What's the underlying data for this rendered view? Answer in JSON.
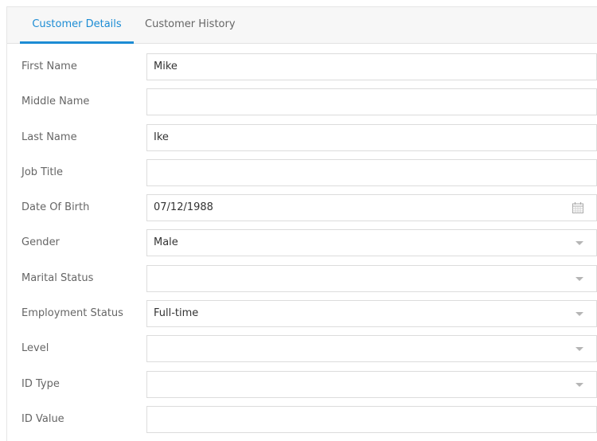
{
  "tabs": [
    {
      "label": "Customer Details",
      "active": true
    },
    {
      "label": "Customer History",
      "active": false
    }
  ],
  "accent_color": "#1c8cd4",
  "fields": {
    "first_name": {
      "label": "First Name",
      "value": "Mike"
    },
    "middle_name": {
      "label": "Middle Name",
      "value": ""
    },
    "last_name": {
      "label": "Last Name",
      "value": "Ike"
    },
    "job_title": {
      "label": "Job Title",
      "value": ""
    },
    "date_of_birth": {
      "label": "Date Of Birth",
      "value": "07/12/1988",
      "icon": "calendar-icon"
    },
    "gender": {
      "label": "Gender",
      "value": "Male",
      "icon": "chevron-down-icon"
    },
    "marital_status": {
      "label": "Marital Status",
      "value": "",
      "icon": "chevron-down-icon"
    },
    "employment_status": {
      "label": "Employment Status",
      "value": "Full-time",
      "icon": "chevron-down-icon"
    },
    "level": {
      "label": "Level",
      "value": "",
      "icon": "chevron-down-icon"
    },
    "id_type": {
      "label": "ID Type",
      "value": "",
      "icon": "chevron-down-icon"
    },
    "id_value": {
      "label": "ID Value",
      "value": ""
    }
  }
}
